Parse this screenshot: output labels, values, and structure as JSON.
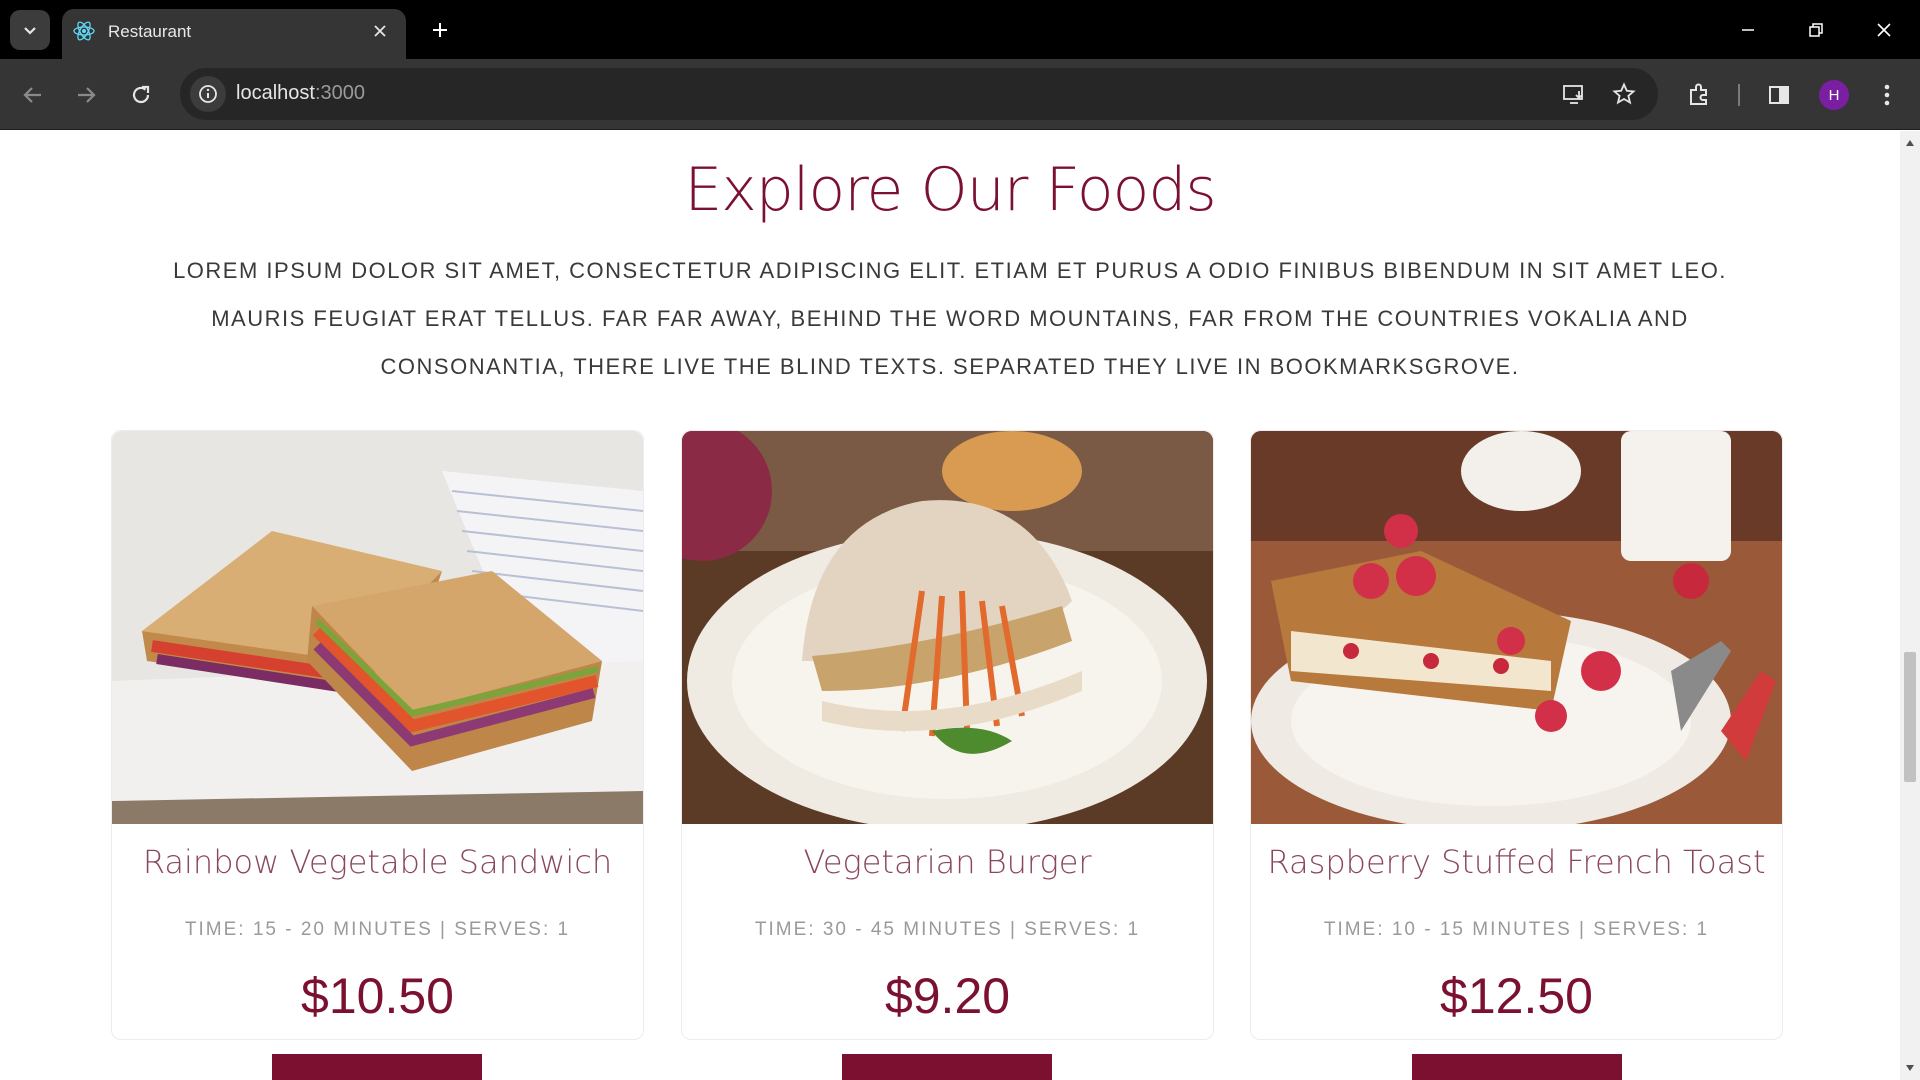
{
  "browser": {
    "tab_title": "Restaurant",
    "url_host": "localhost",
    "url_port": ":3000",
    "profile_initial": "H"
  },
  "section": {
    "title": "Explore Our Foods",
    "description": "Lorem ipsum dolor sit amet, consectetur adipiscing elit. Etiam et purus a odio finibus bibendum in sit amet leo. Mauris feugiat erat tellus. Far far away, behind the word mountains, far from the countries Vokalia and Consonantia, there live the blind texts. Separated they live in Bookmarksgrove."
  },
  "foods": [
    {
      "name": "Rainbow Vegetable Sandwich",
      "meta": "TIME: 15 - 20 MINUTES | SERVES: 1",
      "price": "$10.50"
    },
    {
      "name": "Vegetarian Burger",
      "meta": "TIME: 30 - 45 MINUTES | SERVES: 1",
      "price": "$9.20"
    },
    {
      "name": "Raspberry Stuffed French Toast",
      "meta": "TIME: 10 - 15 MINUTES | SERVES: 1",
      "price": "$12.50"
    }
  ],
  "colors": {
    "accent": "#7b1030",
    "title_color": "#8a4660"
  }
}
